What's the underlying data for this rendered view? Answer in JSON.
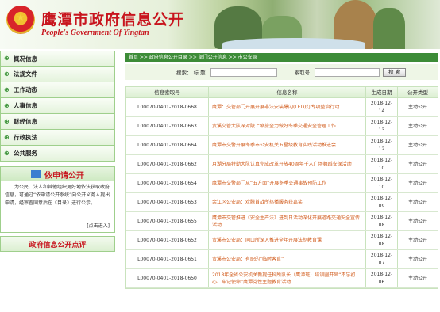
{
  "header": {
    "title": "鹰潭市政府信息公开",
    "subtitle": "People's Government Of Yingtan"
  },
  "sidebar": {
    "items": [
      {
        "label": "概况信息"
      },
      {
        "label": "法规文件"
      },
      {
        "label": "工作动态"
      },
      {
        "label": "人事信息"
      },
      {
        "label": "财经信息"
      },
      {
        "label": "行政执法"
      },
      {
        "label": "公共服务"
      }
    ],
    "apply": {
      "title": "依申请公开",
      "body": "为公民、法人和其他组织更好地依法获取政府信息，可通过“依申请公开系统”向公开义务人提出申请，经审查同意后在《目录》进行公示。",
      "link": "[点击进入]"
    },
    "review": "政府信息公开点评"
  },
  "breadcrumb": "首页 >> 政府信息公开目录 >> 部门公开信息 >> 市公安局",
  "search": {
    "label1": "搜索：  标  题",
    "label2": "索取号",
    "button": "搜 索"
  },
  "table": {
    "headers": {
      "no": "信息索取号",
      "name": "信息名称",
      "date": "生成日期",
      "type": "公开类型"
    },
    "rows": [
      {
        "no": "L00070-0401-2018-0668",
        "name": "鹰潭：交管部门开展开展非法安装爆闪(LED)灯专项整治行动",
        "date": "2018-12-\n14",
        "type": "主动公开"
      },
      {
        "no": "L00070-0401-2018-0663",
        "name": "贵溪交管大队深对陵上缩旅全力做好冬季交通安全管理工作",
        "date": "2018-12-\n13",
        "type": "主动公开"
      },
      {
        "no": "L00070-0401-2018-0664",
        "name": "鹰潭市交警开展冬季市公安机关五星级教育实践活动推进会",
        "date": "2018-12-\n12",
        "type": "主动公开"
      },
      {
        "no": "L00070-0401-2018-0662",
        "name": "月湖分局特勤大队认真完成改革开放40周年千人广场舞蹈安保活动",
        "date": "2018-12-\n10",
        "type": "主动公开"
      },
      {
        "no": "L00070-0401-2018-0654",
        "name": "鹰潭市交警部门从“五方面”开展冬季交通事故预防工作",
        "date": "2018-12-\n10",
        "type": "主动公开"
      },
      {
        "no": "L00070-0401-2018-0653",
        "name": "余江区公安局：欢腾首战所热播服务获嘉奖",
        "date": "2018-12-\n09",
        "type": "主动公开"
      },
      {
        "no": "L00070-0401-2018-0655",
        "name": "鹰潭市交管推进《安全生产法》进到日活动深化开展道路交通安全宣传活动",
        "date": "2018-12-\n08",
        "type": "主动公开"
      },
      {
        "no": "L00070-0401-2018-0652",
        "name": "贵溪市公安局：同口所深入推进全年开展法制教育课",
        "date": "2018-12-\n08",
        "type": "主动公开"
      },
      {
        "no": "L00070-0401-2018-0651",
        "name": "贵溪市公安局：有职的“临时客官”",
        "date": "2018-12-\n07",
        "type": "主动公开"
      },
      {
        "no": "L00070-0401-2018-0650",
        "name": "2018年全省公安机关新提任科所队长（鹰潭班）培训圆开显“不忘初心、牢记使命”鹰潭党性主题教育活动",
        "date": "2018-12-\n06",
        "type": "主动公开"
      }
    ]
  }
}
